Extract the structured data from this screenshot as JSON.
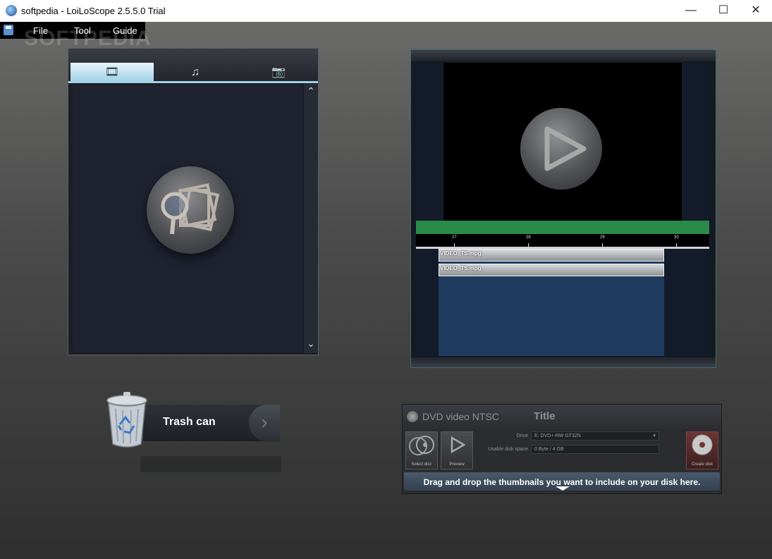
{
  "window": {
    "title": "softpedia - LoiLoScope 2.5.5.0 Trial",
    "controls": {
      "minimize": "—",
      "maximize": "☐",
      "close": "✕"
    }
  },
  "menu": {
    "items": [
      {
        "label": "File"
      },
      {
        "label": "Tool"
      },
      {
        "label": "Guide"
      }
    ],
    "watermark": "SOFTPEDIA"
  },
  "media_panel": {
    "tabs": [
      {
        "icon": "film-icon",
        "glyph": "🎞",
        "active": true
      },
      {
        "icon": "music-icon",
        "glyph": "♫",
        "active": false
      },
      {
        "icon": "camera-icon",
        "glyph": "📷",
        "active": false
      }
    ],
    "scroll_up": "⌃",
    "scroll_down": "⌄"
  },
  "preview": {
    "ruler_ticks": [
      "27",
      "28",
      "29",
      "30"
    ],
    "clips": [
      {
        "name": "VIDEO_TS.mpg"
      },
      {
        "name": "VIDEO_TS.mpg"
      }
    ],
    "colors": {
      "green_bar": "#2a8a4a",
      "track": "#1e3b5f"
    }
  },
  "trash": {
    "label": "Trash can",
    "arrow": "›"
  },
  "disc": {
    "format": "DVD video NTSC",
    "title": "Title",
    "drive_label": "Drive",
    "drive_value": "E:  DVD+-RW GT32N",
    "space_label": "Usable disk space",
    "space_value": "0 Byte / 4 GB",
    "select_disc": "Select disc",
    "preview": "Preview",
    "create_disc": "Create disk",
    "hint": "Drag and drop the thumbnails you want to include on your disk here."
  }
}
